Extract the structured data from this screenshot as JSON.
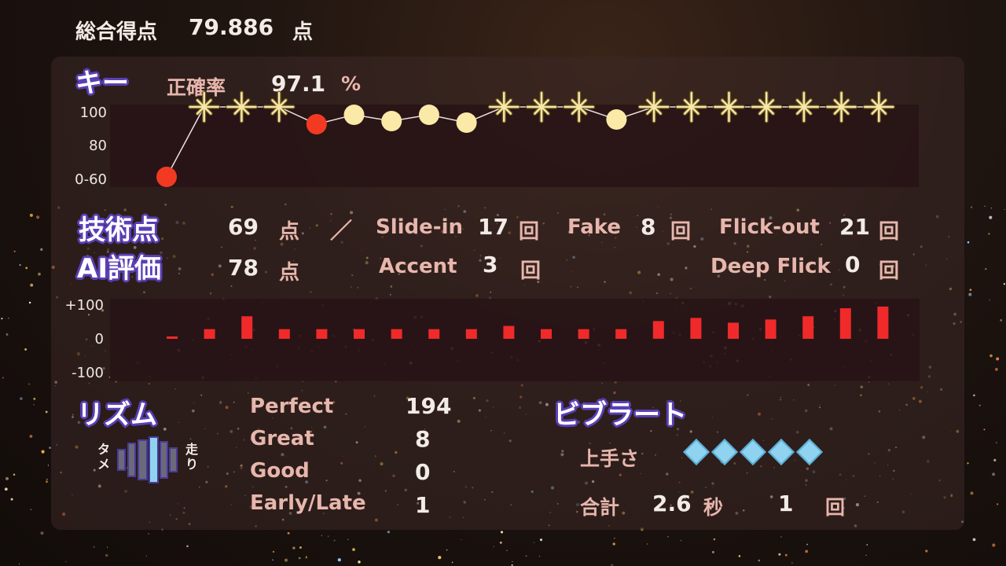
{
  "header": {
    "label": "総合得点",
    "score": "79.886",
    "unit": "点"
  },
  "key": {
    "heading": "キー",
    "accuracy_label": "正確率",
    "accuracy_value": "97.1",
    "accuracy_unit": "%",
    "y_ticks": [
      "100",
      "80",
      "0-60"
    ],
    "points": [
      "low",
      "star",
      "star",
      "star",
      "mid-red",
      "mid",
      "mid",
      "mid",
      "mid",
      "star",
      "star",
      "star",
      "mid",
      "star",
      "star",
      "star",
      "star",
      "star",
      "star",
      "star"
    ],
    "colors": {
      "star": "#f7e7a6",
      "mid": "#fbe9a8",
      "red": "#f23a22"
    }
  },
  "technique": {
    "heading": "技術点",
    "score": "69",
    "unit": "点",
    "separator": "／",
    "slidein_label": "Slide-in",
    "slidein_count": "17",
    "slidein_unit": "回",
    "fake_label": "Fake",
    "fake_count": "8",
    "fake_unit": "回",
    "flickout_label": "Flick-out",
    "flickout_count": "21",
    "flickout_unit": "回"
  },
  "ai": {
    "heading": "AI評価",
    "score": "78",
    "unit": "点",
    "accent_label": "Accent",
    "accent_count": "3",
    "accent_unit": "回",
    "deepflick_label": "Deep Flick",
    "deepflick_count": "0",
    "deepflick_unit": "回"
  },
  "chart_data": {
    "type": "bar",
    "y_ticks": [
      "+100",
      "0",
      "-100"
    ],
    "ylim": [
      -100,
      100
    ],
    "values": [
      3,
      30,
      70,
      30,
      30,
      30,
      30,
      30,
      30,
      40,
      30,
      30,
      30,
      55,
      65,
      50,
      60,
      70,
      95,
      100
    ],
    "color": "#f02a2a"
  },
  "rhythm": {
    "heading": "リズム",
    "left_label": "タメ",
    "right_label": "走り",
    "rows": [
      {
        "label": "Perfect",
        "value": "194"
      },
      {
        "label": "Great",
        "value": "8"
      },
      {
        "label": "Good",
        "value": "0"
      },
      {
        "label": "Early/Late",
        "value": "1"
      }
    ]
  },
  "vibrato": {
    "heading": "ビブラート",
    "skill_label": "上手さ",
    "skill_level": 5,
    "total_label": "合計",
    "total_seconds": "2.6",
    "seconds_unit": "秒",
    "count": "1",
    "count_unit": "回",
    "diamond_color": "#8fd3f0"
  }
}
